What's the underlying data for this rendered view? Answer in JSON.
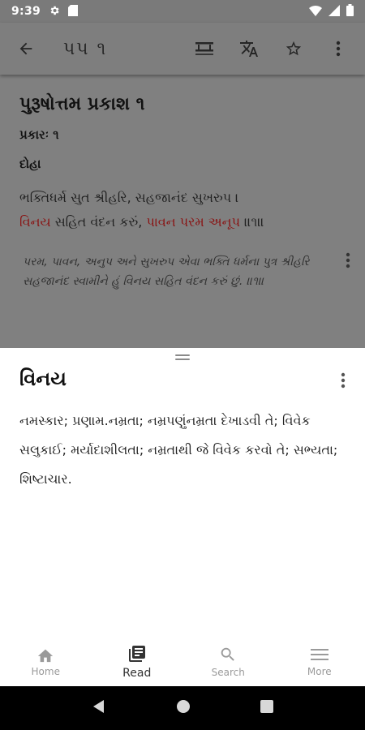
{
  "status": {
    "time": "9:39",
    "icons": [
      "gear-icon",
      "sd-card-icon",
      "wifi-icon",
      "signal-icon",
      "battery-icon"
    ]
  },
  "appbar": {
    "title": "પપ ૧",
    "actions": [
      "reading-mode-icon",
      "translate-icon",
      "star-icon",
      "more-vert-icon"
    ]
  },
  "content": {
    "book_title": "પુરૂષોત્તમ પ્રકાશ ૧",
    "chapter": "પ્રકારઃ ૧",
    "section": "દોહા",
    "verse_line1": "ભક્તિધર્મ સુત શ્રીહરિ, સહજાનંદ સુખરુપ ।",
    "verse_line2_a": "વિનય",
    "verse_line2_b": " સહિત વંદન કરું, ",
    "verse_line2_c": "પાવન પરમ અનૂપ",
    "verse_line2_d": " ॥૧॥",
    "commentary": "પરમ, પાવન, અનુપ અને સુખરુપ એવા ભક્તિ ધર્મના પુત્ર શ્રીહરિ સહજાનંદ સ્વામીને હું વિનય સહિત વંદન કરું છું. ॥૧॥"
  },
  "sheet": {
    "word": "વિનય",
    "definition": "નમસ્કાર; પ્રણામ.નમ્રતા; નમ્રપણુંનમ્રતા દેખાડવી તે; વિવેક સલુકાઈ; મર્યાદાશીલતા; નમ્રતાથી જે વિવેક કરવો તે; સભ્યતા; શિષ્ટાચાર."
  },
  "bottom_nav": {
    "items": [
      {
        "label": "Home",
        "icon": "home-icon",
        "active": false
      },
      {
        "label": "Read",
        "icon": "read-icon",
        "active": true
      },
      {
        "label": "Search",
        "icon": "search-icon",
        "active": false
      },
      {
        "label": "More",
        "icon": "menu-icon",
        "active": false
      }
    ]
  },
  "colors": {
    "scrim": "#808080",
    "highlight": "#8a1010",
    "nav_inactive": "#9a9a9a",
    "nav_active": "#333333"
  }
}
